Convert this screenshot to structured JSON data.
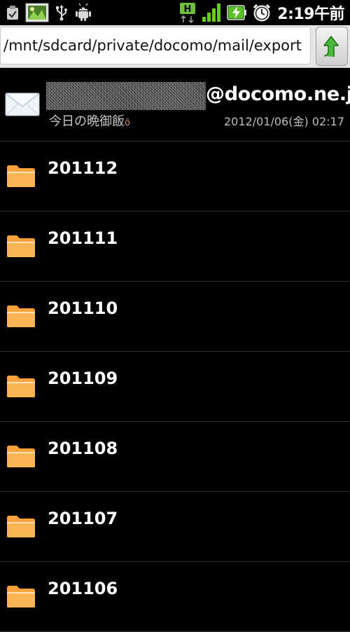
{
  "status_bar": {
    "time": "2:19午前",
    "left_icons": [
      "clipboard-check-icon",
      "picture-notification-icon",
      "usb-icon",
      "android-debug-icon"
    ],
    "right_icons": [
      "hsdpa-data-icon",
      "signal-strength-icon",
      "battery-charging-icon",
      "alarm-clock-icon"
    ],
    "network_badge": "H"
  },
  "path_bar": {
    "path": "/mnt/sdcard/private/docomo/mail/export",
    "up_button_icon": "up-arrow-icon"
  },
  "mail_item": {
    "icon": "envelope-icon",
    "sender_domain": "@docomo.ne.jp",
    "subject": "今日の晩御飯",
    "date": "2012/01/06(金) 02:17"
  },
  "folders": [
    {
      "name": "201112",
      "icon": "folder-icon"
    },
    {
      "name": "201111",
      "icon": "folder-icon"
    },
    {
      "name": "201110",
      "icon": "folder-icon"
    },
    {
      "name": "201109",
      "icon": "folder-icon"
    },
    {
      "name": "201108",
      "icon": "folder-icon"
    },
    {
      "name": "201107",
      "icon": "folder-icon"
    },
    {
      "name": "201106",
      "icon": "folder-icon"
    }
  ],
  "colors": {
    "background": "#000000",
    "folder_orange": "#f7a23c",
    "signal_green": "#66cc22",
    "up_arrow_green": "#3aa83a"
  }
}
